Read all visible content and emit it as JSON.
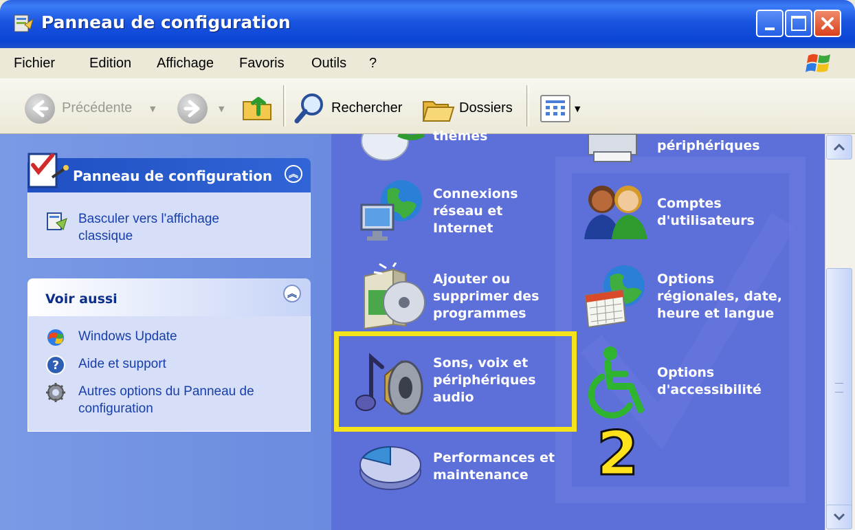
{
  "window": {
    "title": "Panneau de configuration",
    "buttons": {
      "minimize": "_",
      "maximize": "□",
      "close": "✕"
    }
  },
  "menu": {
    "items": [
      "Fichier",
      "Edition",
      "Affichage",
      "Favoris",
      "Outils",
      "?"
    ]
  },
  "toolbar": {
    "back_label": "Précédente",
    "search_label": "Rechercher",
    "folders_label": "Dossiers"
  },
  "sidebar": {
    "panel1": {
      "title": "Panneau de configuration",
      "task": "Basculer vers l'affichage classique"
    },
    "panel2": {
      "title": "Voir aussi",
      "links": [
        "Windows Update",
        "Aide et support",
        "Autres options du Panneau de configuration"
      ]
    }
  },
  "categories": [
    {
      "label": "thèmes"
    },
    {
      "label": "périphériques"
    },
    {
      "label": "Connexions réseau et Internet"
    },
    {
      "label": "Comptes d'utilisateurs"
    },
    {
      "label": "Ajouter ou supprimer des programmes"
    },
    {
      "label": "Options régionales, date, heure et langue"
    },
    {
      "label": "Sons, voix et périphériques audio"
    },
    {
      "label": "Options d'accessibilité"
    },
    {
      "label": "Performances et maintenance"
    }
  ],
  "annotation": {
    "step_number": "2"
  },
  "colors": {
    "titlebar": "#0b44d4",
    "main_background": "#5d6fd9",
    "highlight": "#f5e31b"
  }
}
